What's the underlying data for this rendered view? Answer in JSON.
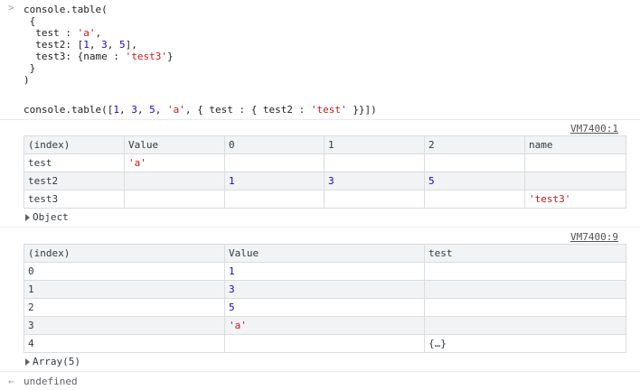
{
  "input": {
    "lines": [
      "console.table(",
      " {",
      "  test : 'a',",
      "  test2: [1, 3, 5],",
      "  test3: {name : 'test3'}",
      " }",
      ")"
    ],
    "prompt_glyph": ">"
  },
  "command2": "console.table([1, 3, 5, 'a', { test : { test2 : 'test' }}])",
  "table1": {
    "source": "VM7400:1",
    "headers": [
      "(index)",
      "Value",
      "0",
      "1",
      "2",
      "name"
    ],
    "rows": [
      [
        "test",
        "'a'",
        "",
        "",
        "",
        ""
      ],
      [
        "test2",
        "",
        "1",
        "3",
        "5",
        ""
      ],
      [
        "test3",
        "",
        "",
        "",
        "",
        "'test3'"
      ]
    ],
    "expander": "Object"
  },
  "table2": {
    "source": "VM7400:9",
    "headers": [
      "(index)",
      "Value",
      "test"
    ],
    "rows": [
      [
        "0",
        "1",
        ""
      ],
      [
        "1",
        "3",
        ""
      ],
      [
        "2",
        "5",
        ""
      ],
      [
        "3",
        "'a'",
        ""
      ],
      [
        "4",
        "",
        "{…}"
      ]
    ],
    "expander": "Array(5)"
  },
  "result": {
    "glyph": "←",
    "text": "undefined"
  },
  "colors": {
    "string": "#c41a16",
    "number": "#1c00cf",
    "header_bg": "#f1f3f4",
    "border": "#dadce0"
  }
}
